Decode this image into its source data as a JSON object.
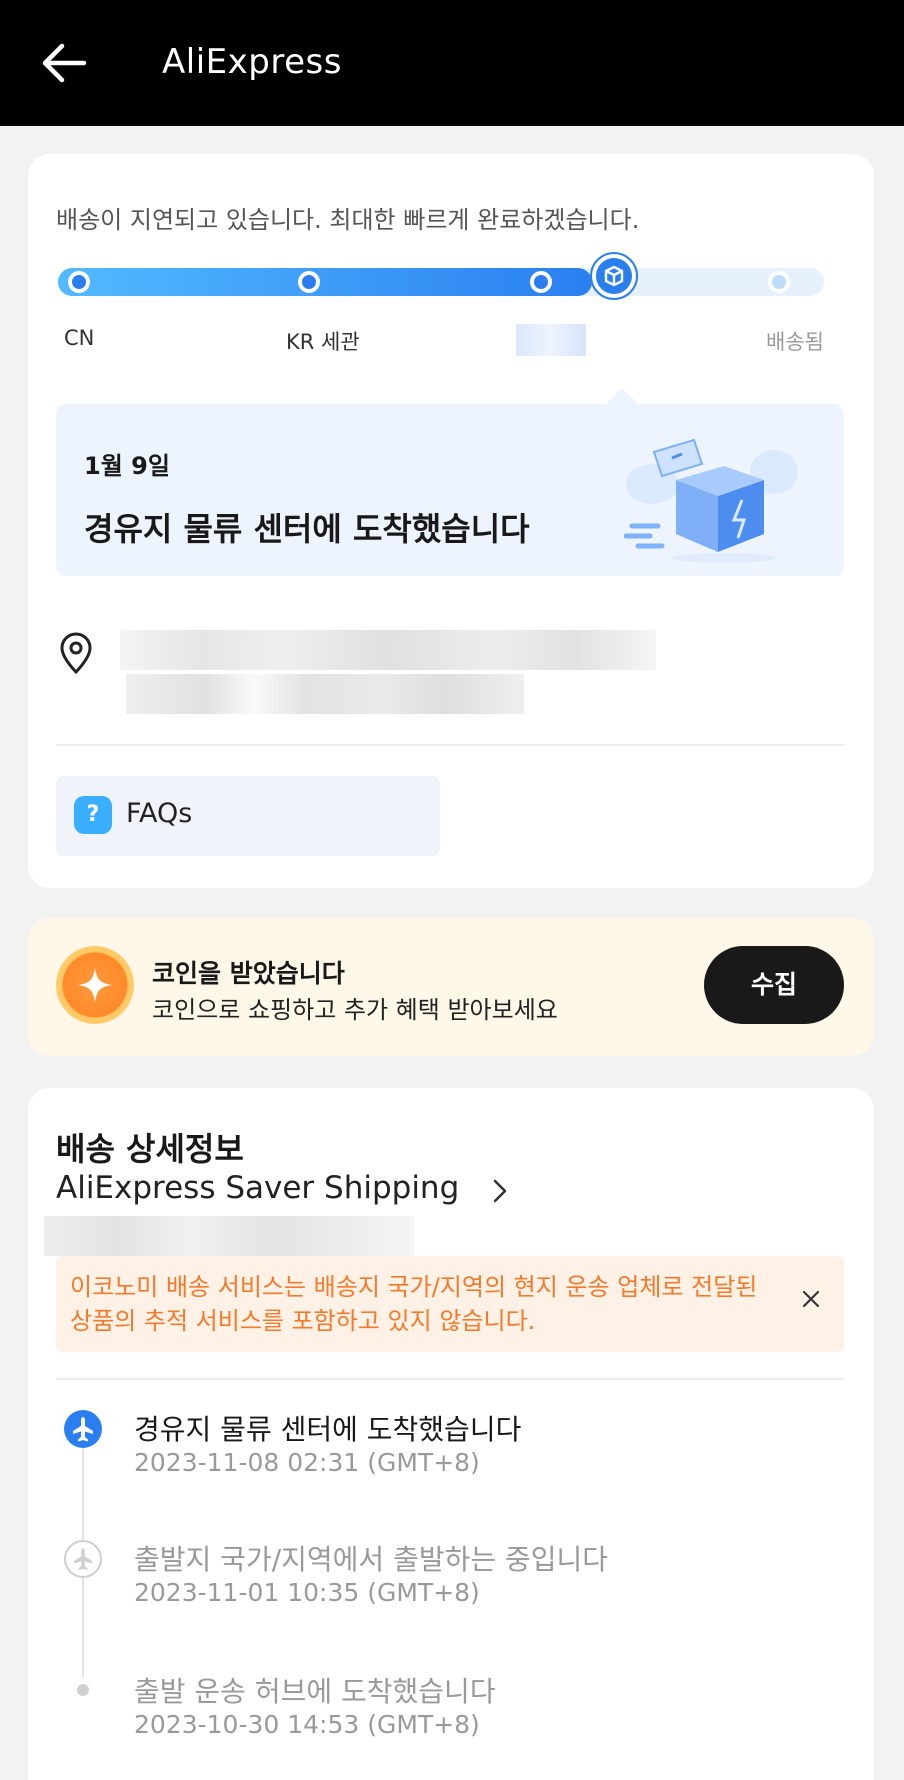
{
  "appbar": {
    "title": "AliExpress"
  },
  "tracking": {
    "delay_message": "배송이 지연되고 있습니다. 최대한 빠르게 완료하겠습니다.",
    "progress_fraction": 0.7,
    "stages": [
      "CN",
      "KR 세관",
      "배송됨"
    ],
    "latest_date": "1월 9일",
    "latest_status": "경유지 물류 센터에 도착했습니다"
  },
  "faq": {
    "label": "FAQs",
    "icon": "?"
  },
  "coins": {
    "title": "코인을 받았습니다",
    "subtitle": "코인으로 쇼핑하고 추가 혜택 받아보세요",
    "button": "수집"
  },
  "details": {
    "title": "배송 상세정보",
    "method": "AliExpress Saver Shipping",
    "notice": "이코노미 배송 서비스는 배송지 국가/지역의 현지 운송 업체로 전달된 상품의 추적 서비스를 포함하고 있지 않습니다.",
    "events": [
      {
        "title": "경유지 물류 센터에 도착했습니다",
        "time": "2023-11-08 02:31 (GMT+8)"
      },
      {
        "title": "출발지 국가/지역에서 출발하는 중입니다",
        "time": "2023-11-01 10:35 (GMT+8)"
      },
      {
        "title": "출발 운송 허브에 도착했습니다",
        "time": "2023-10-30 14:53 (GMT+8)"
      }
    ]
  },
  "colors": {
    "accent": "#2a7ff0",
    "notice": "#f5792a",
    "coin_bg": "#fff8e9"
  }
}
